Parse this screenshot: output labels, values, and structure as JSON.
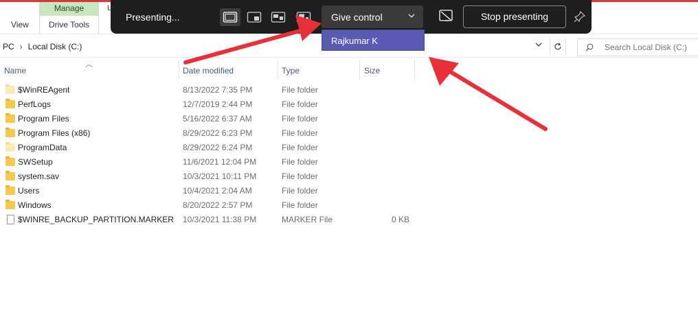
{
  "ribbon": {
    "view_tab": "View",
    "manage_label": "Manage",
    "drive_tools_tab": "Drive Tools",
    "partial_tab": "L"
  },
  "address": {
    "prefix": "PC",
    "location": "Local Disk (C:)",
    "search_placeholder": "Search Local Disk (C:)"
  },
  "columns": {
    "name": "Name",
    "date_modified": "Date modified",
    "type": "Type",
    "size": "Size"
  },
  "files": [
    {
      "name": "$WinREAgent",
      "date": "8/13/2022 7:35 PM",
      "type": "File folder",
      "size": "",
      "icon": "folder-faded-icon"
    },
    {
      "name": "PerfLogs",
      "date": "12/7/2019 2:44 PM",
      "type": "File folder",
      "size": "",
      "icon": "folder-icon"
    },
    {
      "name": "Program Files",
      "date": "5/16/2022 6:37 AM",
      "type": "File folder",
      "size": "",
      "icon": "folder-icon"
    },
    {
      "name": "Program Files (x86)",
      "date": "8/29/2022 6:23 PM",
      "type": "File folder",
      "size": "",
      "icon": "folder-icon"
    },
    {
      "name": "ProgramData",
      "date": "8/29/2022 6:24 PM",
      "type": "File folder",
      "size": "",
      "icon": "folder-faded-icon"
    },
    {
      "name": "SWSetup",
      "date": "11/6/2021 12:04 PM",
      "type": "File folder",
      "size": "",
      "icon": "folder-icon"
    },
    {
      "name": "system.sav",
      "date": "10/3/2021 10:11 PM",
      "type": "File folder",
      "size": "",
      "icon": "folder-icon"
    },
    {
      "name": "Users",
      "date": "10/4/2021 2:04 AM",
      "type": "File folder",
      "size": "",
      "icon": "folder-icon"
    },
    {
      "name": "Windows",
      "date": "8/20/2022 2:57 PM",
      "type": "File folder",
      "size": "",
      "icon": "folder-icon"
    },
    {
      "name": "$WINRE_BACKUP_PARTITION.MARKER",
      "date": "10/3/2021 11:38 PM",
      "type": "MARKER File",
      "size": "0 KB",
      "icon": "file-icon"
    }
  ],
  "presenting": {
    "status": "Presenting...",
    "give_control_label": "Give control",
    "stop_label": "Stop presenting",
    "dropdown_options": [
      "Rajkumar K"
    ]
  },
  "colors": {
    "toolbar_bg": "#1e1e1e",
    "dropdown_bg": "#5a5ab2",
    "annotation_arrow": "#e8303a",
    "manage_tab_bg": "#c8e6c0"
  }
}
